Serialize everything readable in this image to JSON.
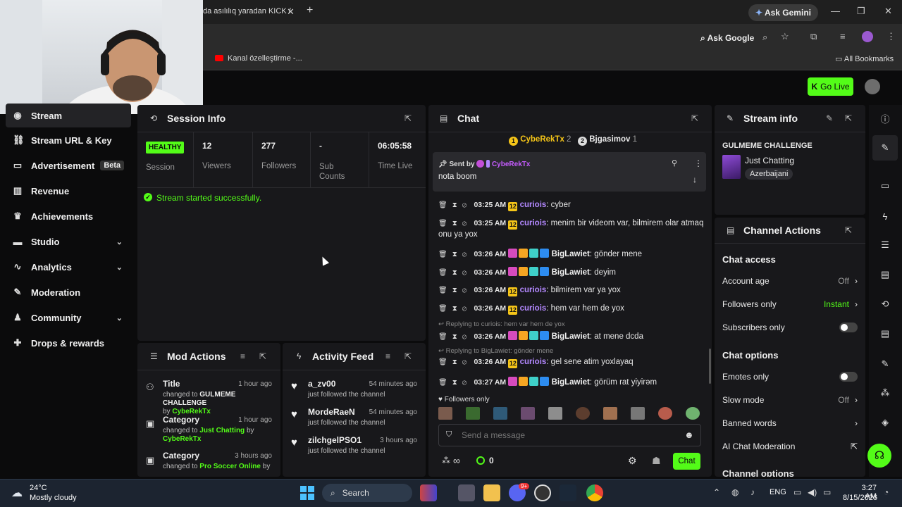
{
  "browser": {
    "tab_title": "da asılılıq yaradan KICK /",
    "ask_gemini": "Ask Gemini",
    "ask_google": "Ask Google",
    "bookmark_item": "Kanal özelleştirme -...",
    "all_bookmarks": "All Bookmarks"
  },
  "header": {
    "go_live": "Go Live"
  },
  "sidebar": {
    "items": [
      {
        "label": "Stream",
        "icon": "stream-icon"
      },
      {
        "label": "Stream URL & Key",
        "icon": "link-icon"
      },
      {
        "label": "Advertisement",
        "badge": "Beta",
        "icon": "ad-icon"
      },
      {
        "label": "Revenue",
        "icon": "chart-icon"
      },
      {
        "label": "Achievements",
        "icon": "trophy-icon"
      },
      {
        "label": "Studio",
        "icon": "studio-icon"
      },
      {
        "label": "Analytics",
        "icon": "analytics-icon"
      },
      {
        "label": "Moderation",
        "icon": "wrench-icon"
      },
      {
        "label": "Community",
        "icon": "community-icon"
      },
      {
        "label": "Drops & rewards",
        "icon": "gift-icon"
      }
    ]
  },
  "session": {
    "title": "Session Info",
    "status_badge": "HEALTHY",
    "stats": [
      {
        "value": "",
        "label": "Session"
      },
      {
        "value": "12",
        "label": "Viewers"
      },
      {
        "value": "277",
        "label": "Followers"
      },
      {
        "value": "-",
        "label": "Sub Counts"
      },
      {
        "value": "06:05:58",
        "label": "Time Live"
      }
    ],
    "notice": "Stream started successfully."
  },
  "mod_actions": {
    "title": "Mod Actions",
    "items": [
      {
        "title": "Title",
        "time": "1 hour ago",
        "changed": "changed to",
        "value": "GULMEME CHALLENGE",
        "by": "by",
        "user": "CybeRekTx"
      },
      {
        "title": "Category",
        "time": "1 hour ago",
        "changed": "changed to",
        "value": "Just Chatting",
        "by": "by",
        "user": "CybeRekTx"
      },
      {
        "title": "Category",
        "time": "3 hours ago",
        "changed": "changed to",
        "value": "Pro Soccer Online",
        "by": "by",
        "user": ""
      }
    ]
  },
  "activity": {
    "title": "Activity Feed",
    "items": [
      {
        "user": "a_zv00",
        "time": "54 minutes ago",
        "text": "just followed the channel"
      },
      {
        "user": "MordeRaeN",
        "time": "54 minutes ago",
        "text": "just followed the channel"
      },
      {
        "user": "zilchgelPSO1",
        "time": "3 hours ago",
        "text": "just followed the channel"
      }
    ]
  },
  "chat": {
    "title": "Chat",
    "top_gifters": [
      {
        "name": "CybeRekTx",
        "count": "2",
        "rank": "1"
      },
      {
        "name": "Bjgasimov",
        "count": "1",
        "rank": "2"
      }
    ],
    "pinned": {
      "sent_by": "Sent by",
      "user": "CybeRekTx",
      "text": "nota boom"
    },
    "messages": [
      {
        "time": "03:25 AM",
        "user": "curiois",
        "text": ": cyber"
      },
      {
        "time": "03:25 AM",
        "user": "curiois",
        "text": ": menim bir videom var, bilmirem olar atmaq",
        "cont": "onu ya yox"
      },
      {
        "time": "03:26 AM",
        "user": "BigLawiet",
        "text": ": gönder mene"
      },
      {
        "time": "03:26 AM",
        "user": "BigLawiet",
        "text": ": deyim"
      },
      {
        "time": "03:26 AM",
        "user": "curiois",
        "text": ": bilmirem var ya yox"
      },
      {
        "time": "03:26 AM",
        "user": "curiois",
        "text": ": hem var hem de yox"
      },
      {
        "reply": "Replying to curiois: hem var hem de yox",
        "time": "03:26 AM",
        "user": "BigLawiet",
        "text": ": at mene dcda"
      },
      {
        "reply": "Replying to BigLawiet: gönder mene",
        "time": "03:26 AM",
        "user": "curiois",
        "text": ": gel sene atim yoxlayaq"
      },
      {
        "time": "03:27 AM",
        "user": "BigLawiet",
        "text": ": görüm rat yiyirəm"
      }
    ],
    "followers_only": "Followers only",
    "input_placeholder": "Send a message",
    "points": "∞",
    "kicks": "0",
    "send_label": "Chat"
  },
  "stream_info": {
    "title": "Stream info",
    "stream_title": "GULMEME CHALLENGE",
    "category": "Just Chatting",
    "tag": "Azerbaijani"
  },
  "channel_actions": {
    "title": "Channel Actions",
    "chat_access": "Chat access",
    "account_age": {
      "label": "Account age",
      "value": "Off"
    },
    "followers_only": {
      "label": "Followers only",
      "value": "Instant"
    },
    "subscribers_only": {
      "label": "Subscribers only"
    },
    "chat_options": "Chat options",
    "emotes_only": {
      "label": "Emotes only"
    },
    "slow_mode": {
      "label": "Slow mode",
      "value": "Off"
    },
    "banned_words": {
      "label": "Banned words"
    },
    "ai_moderation": {
      "label": "AI Chat Moderation"
    },
    "channel_options": "Channel options"
  },
  "taskbar": {
    "weather_temp": "24°C",
    "weather_desc": "Mostly cloudy",
    "search": "Search",
    "lang": "ENG",
    "time": "3:27 AM",
    "date": "8/15/2026",
    "discord_badge": "9+"
  },
  "colors": {
    "accent": "#53fc18",
    "panel": "#18181b",
    "username_purple": "#b388ff"
  }
}
